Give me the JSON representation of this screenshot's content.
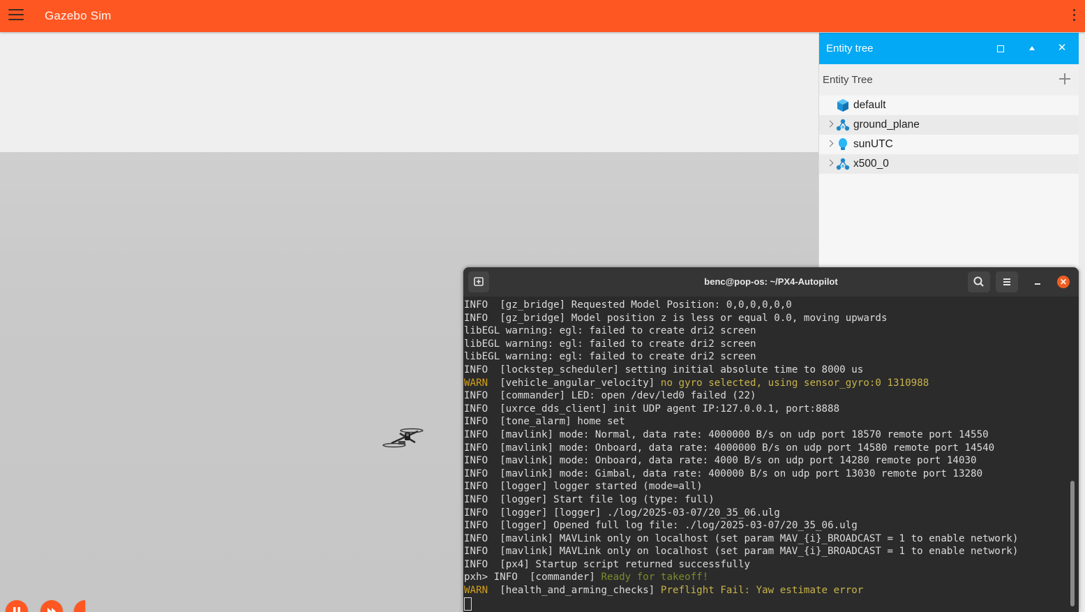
{
  "app": {
    "title": "Gazebo Sim",
    "colors": {
      "appbar": "#fe5722",
      "panel_header": "#03a9f4"
    }
  },
  "entity_panel": {
    "title": "Entity tree",
    "section_title": "Entity Tree",
    "items": [
      {
        "label": "default",
        "icon": "world-cube-icon",
        "expandable": false
      },
      {
        "label": "ground_plane",
        "icon": "model-icon",
        "expandable": true
      },
      {
        "label": "sunUTC",
        "icon": "light-bulb-icon",
        "expandable": true
      },
      {
        "label": "x500_0",
        "icon": "model-icon",
        "expandable": true
      }
    ]
  },
  "terminal": {
    "title": "benc@pop-os: ~/PX4-Autopilot",
    "lines": [
      {
        "lvl": "INFO",
        "tag": "[gz_bridge]",
        "msg": "Requested Model Position: 0,0,0,0,0,0"
      },
      {
        "lvl": "INFO",
        "tag": "[gz_bridge]",
        "msg": "Model position z is less or equal 0.0, moving upwards"
      },
      {
        "raw": "libEGL warning: egl: failed to create dri2 screen"
      },
      {
        "raw": "libEGL warning: egl: failed to create dri2 screen"
      },
      {
        "raw": "libEGL warning: egl: failed to create dri2 screen"
      },
      {
        "lvl": "INFO",
        "tag": "[lockstep_scheduler]",
        "msg": "setting initial absolute time to 8000 us"
      },
      {
        "lvl": "WARN",
        "tag": "[vehicle_angular_velocity]",
        "msg": "no gyro selected, using sensor_gyro:0 1310988"
      },
      {
        "lvl": "INFO",
        "tag": "[commander]",
        "msg": "LED: open /dev/led0 failed (22)"
      },
      {
        "lvl": "INFO",
        "tag": "[uxrce_dds_client]",
        "msg": "init UDP agent IP:127.0.0.1, port:8888"
      },
      {
        "lvl": "INFO",
        "tag": "[tone_alarm]",
        "msg": "home set"
      },
      {
        "lvl": "INFO",
        "tag": "[mavlink]",
        "msg": "mode: Normal, data rate: 4000000 B/s on udp port 18570 remote port 14550"
      },
      {
        "lvl": "INFO",
        "tag": "[mavlink]",
        "msg": "mode: Onboard, data rate: 4000000 B/s on udp port 14580 remote port 14540"
      },
      {
        "lvl": "INFO",
        "tag": "[mavlink]",
        "msg": "mode: Onboard, data rate: 4000 B/s on udp port 14280 remote port 14030"
      },
      {
        "lvl": "INFO",
        "tag": "[mavlink]",
        "msg": "mode: Gimbal, data rate: 400000 B/s on udp port 13030 remote port 13280"
      },
      {
        "lvl": "INFO",
        "tag": "[logger]",
        "msg": "logger started (mode=all)"
      },
      {
        "lvl": "INFO",
        "tag": "[logger]",
        "msg": "Start file log (type: full)"
      },
      {
        "lvl": "INFO",
        "tag": "[logger]",
        "msg": "[logger] ./log/2025-03-07/20_35_06.ulg"
      },
      {
        "lvl": "INFO",
        "tag": "[logger]",
        "msg": "Opened full log file: ./log/2025-03-07/20_35_06.ulg"
      },
      {
        "lvl": "INFO",
        "tag": "[mavlink]",
        "msg": "MAVLink only on localhost (set param MAV_{i}_BROADCAST = 1 to enable network)"
      },
      {
        "lvl": "INFO",
        "tag": "[mavlink]",
        "msg": "MAVLink only on localhost (set param MAV_{i}_BROADCAST = 1 to enable network)"
      },
      {
        "lvl": "INFO",
        "tag": "[px4]",
        "msg": "Startup script returned successfully"
      },
      {
        "prompt": "pxh> ",
        "lvl": "INFO",
        "tag": "[commander]",
        "msg": "Ready for takeoff!",
        "ok": true
      },
      {
        "lvl": "WARN",
        "tag": "[health_and_arming_checks]",
        "msg": "Preflight Fail: Yaw estimate error"
      }
    ]
  }
}
